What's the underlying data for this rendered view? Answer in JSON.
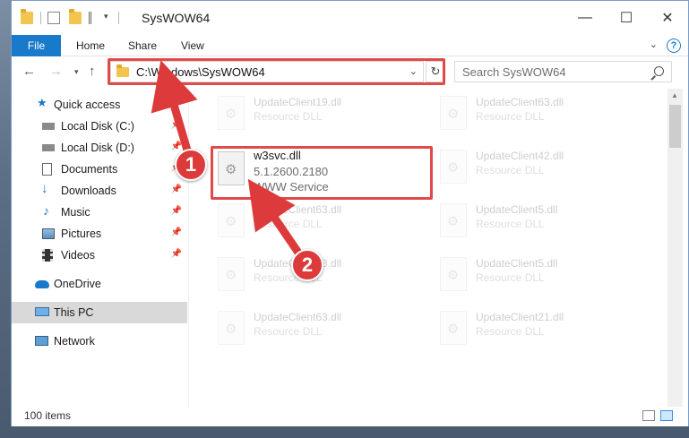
{
  "window": {
    "title": "SysWOW64",
    "controls": {
      "minimize": "—",
      "maximize": "☐",
      "close": "✕"
    }
  },
  "ribbon": {
    "file": "File",
    "tabs": [
      "Home",
      "Share",
      "View"
    ],
    "help": "?"
  },
  "navbar": {
    "address": "C:\\Windows\\SysWOW64",
    "search_placeholder": "Search SysWOW64"
  },
  "navpane": {
    "items": [
      {
        "label": "Quick access",
        "icon": "star-icon",
        "pinned": false
      },
      {
        "label": "Local Disk (C:)",
        "icon": "drive-icon",
        "pinned": true
      },
      {
        "label": "Local Disk (D:)",
        "icon": "drive-icon",
        "pinned": true
      },
      {
        "label": "Documents",
        "icon": "documents-icon",
        "pinned": true
      },
      {
        "label": "Downloads",
        "icon": "download-icon",
        "pinned": true
      },
      {
        "label": "Music",
        "icon": "music-icon",
        "pinned": true
      },
      {
        "label": "Pictures",
        "icon": "pictures-icon",
        "pinned": true
      },
      {
        "label": "Videos",
        "icon": "videos-icon",
        "pinned": true
      },
      {
        "label": "OneDrive",
        "icon": "cloud-icon",
        "pinned": false
      },
      {
        "label": "This PC",
        "icon": "pc-icon",
        "pinned": false,
        "selected": true
      },
      {
        "label": "Network",
        "icon": "network-icon",
        "pinned": false
      }
    ]
  },
  "files": {
    "highlighted": {
      "name": "w3svc.dll",
      "version": "5.1.2600.2180",
      "description": "WWW Service"
    },
    "left_column": [
      {
        "name": "UpdateClient19.dll",
        "description": "Resource DLL"
      },
      {
        "name": "UpdateClient63.dll",
        "description": "Resource DLL"
      },
      {
        "name": "UpdateClient63.dll",
        "description": "Resource DLL"
      },
      {
        "name": "UpdateClient63.dll",
        "description": "Resource DLL"
      }
    ],
    "right_column": [
      {
        "name": "UpdateClient63.dll",
        "description": "Resource DLL"
      },
      {
        "name": "UpdateClient42.dll",
        "description": "Resource DLL"
      },
      {
        "name": "UpdateClient5.dll",
        "description": "Resource DLL"
      },
      {
        "name": "UpdateClient5.dll",
        "description": "Resource DLL"
      },
      {
        "name": "UpdateClient21.dll",
        "description": "Resource DLL"
      }
    ]
  },
  "status": {
    "item_count": "100 items"
  },
  "callouts": [
    "1",
    "2"
  ],
  "colors": {
    "accent": "#1979ca",
    "callout": "#dd3b3b",
    "highlight_border": "#e04a4a"
  }
}
